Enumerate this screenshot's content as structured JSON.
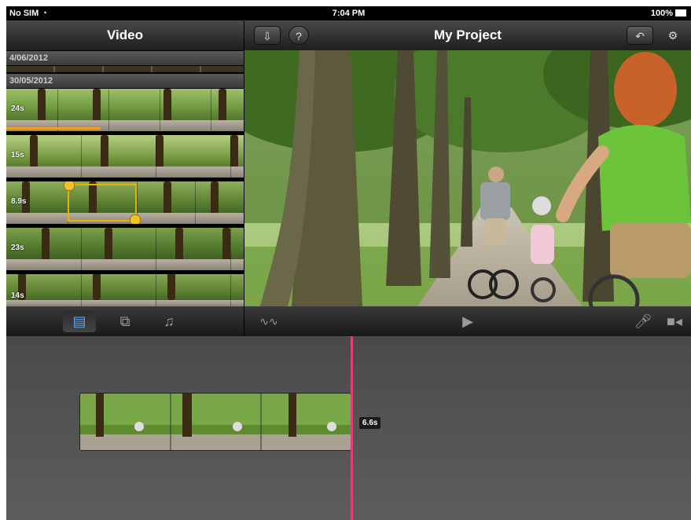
{
  "status": {
    "carrier": "No SIM",
    "time": "7:04 PM",
    "battery": "100%"
  },
  "left": {
    "title": "Video",
    "dates": [
      "4/06/2012",
      "30/05/2012"
    ],
    "clips": [
      {
        "duration": "24s"
      },
      {
        "duration": "15s"
      },
      {
        "duration": "8.9s"
      },
      {
        "duration": "23s"
      },
      {
        "duration": "14s"
      }
    ]
  },
  "header": {
    "title": "My Project"
  },
  "icons": {
    "import": "import-icon",
    "help": "help-icon",
    "undo": "undo-icon",
    "settings": "gear-icon",
    "video_tab": "video-strip-icon",
    "photos_tab": "photos-icon",
    "audio_tab": "music-note-icon",
    "waveform": "audio-waveform-icon",
    "play": "play-icon",
    "mic": "microphone-icon",
    "camera": "camera-icon"
  },
  "timeline": {
    "clip_duration": "6.6s"
  },
  "colors": {
    "accent": "#5aa0e6",
    "playhead": "#e0407a",
    "selection": "#e6b400"
  }
}
